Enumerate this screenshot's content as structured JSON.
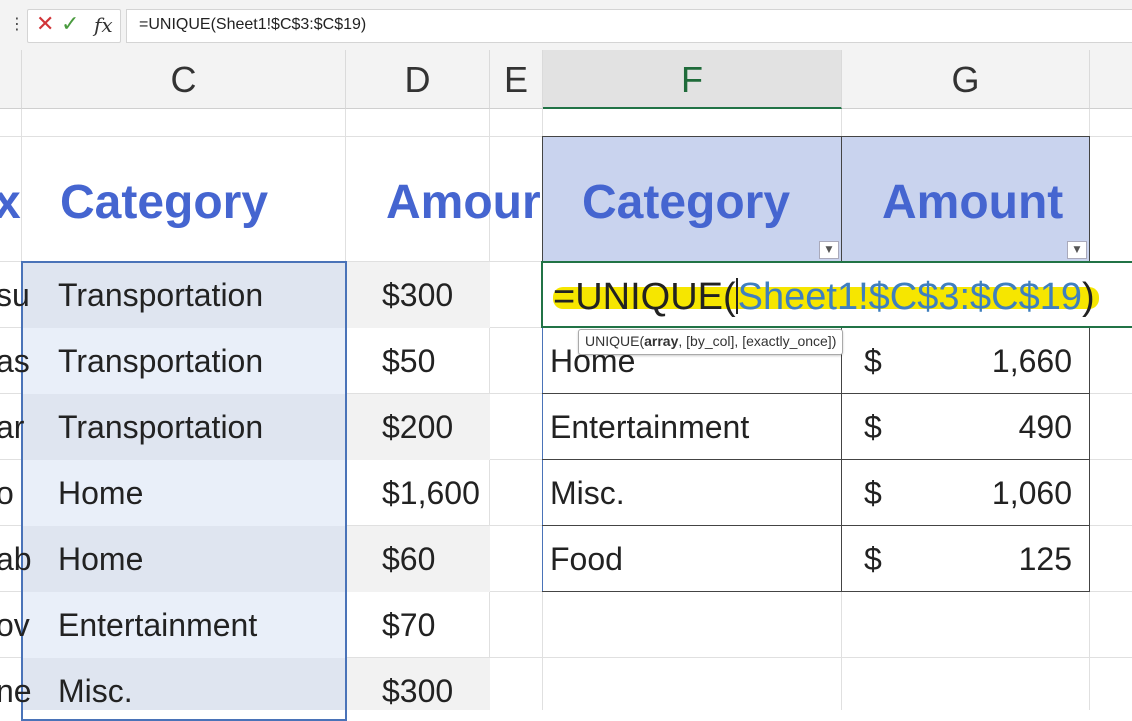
{
  "formula_bar": {
    "grip": "⋮",
    "cancel_icon": "✕",
    "enter_icon": "✓",
    "fx_label": "fx",
    "formula": "=UNIQUE(Sheet1!$C$3:$C$19)"
  },
  "columns": [
    "C",
    "D",
    "E",
    "F",
    "G"
  ],
  "selected_column": "F",
  "source_table": {
    "partial_col_b": [
      "x",
      "su",
      "as",
      "ar",
      "o",
      "ab",
      "ov",
      "ne"
    ],
    "header_category": "Category",
    "header_amount": "Amour",
    "categories": [
      "Transportation",
      "Transportation",
      "Transportation",
      "Home",
      "Home",
      "Entertainment",
      "Misc."
    ],
    "amounts": [
      "$300",
      "$50",
      "$200",
      "$1,600",
      "$60",
      "$70",
      "$300"
    ]
  },
  "summary_table": {
    "header_category": "Category",
    "header_amount": "Amount",
    "edit_formula_prefix": "=UNIQUE(",
    "edit_formula_ref": "Sheet1!$C$3:$C$19",
    "edit_formula_suffix": ")",
    "tooltip_name": "UNIQUE(",
    "tooltip_bold": "array",
    "tooltip_rest": ", [by_col], [exactly_once])",
    "currency_symbol": "$",
    "rows": [
      {
        "category": "Home",
        "amount": "1,660"
      },
      {
        "category": "Entertainment",
        "amount": "490"
      },
      {
        "category": "Misc.",
        "amount": "1,060"
      },
      {
        "category": "Food",
        "amount": "125"
      }
    ]
  },
  "colors": {
    "header_text": "#4565d0",
    "header_fill": "#c9d3ee",
    "range_fill_dark": "#dfe5f0",
    "range_fill_light": "#e9eff9",
    "ref_text": "#3f7fbf",
    "highlight": "#f6e600"
  }
}
